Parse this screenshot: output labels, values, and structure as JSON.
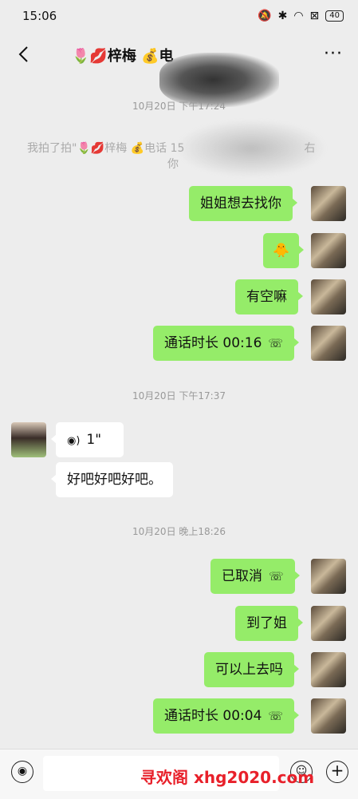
{
  "status_bar": {
    "time": "15:06",
    "icons": [
      "mute-icon",
      "bluetooth-icon",
      "wifi-icon",
      "sim-off-icon"
    ],
    "battery": "40"
  },
  "nav": {
    "back_icon": "‹",
    "title": "🌷💋梓梅 💰电",
    "more_icon": "···"
  },
  "timestamps": [
    "10月20日 下午17:24",
    "10月20日 下午17:37",
    "10月20日 晚上18:26"
  ],
  "system_msg": {
    "line1": "我拍了拍\"🌷💋梓梅 💰电话 15",
    "line1_tail": "右",
    "line2": "你"
  },
  "messages": {
    "m1": "姐姐想去找你",
    "m2": "🐥",
    "m3": "有空嘛",
    "m4": "通话时长 00:16",
    "voice": "1\"",
    "m5": "好吧好吧好吧。",
    "m6": "已取消",
    "m7": "到了姐",
    "m8": "可以上去吗",
    "m9": "通话时长 00:04"
  },
  "input_bar": {
    "watermark": "寻欢阁 xhg2020.com"
  },
  "colors": {
    "bubble_out": "#95ec69",
    "bubble_in": "#ffffff",
    "background": "#ededed",
    "watermark": "#e8202a"
  }
}
